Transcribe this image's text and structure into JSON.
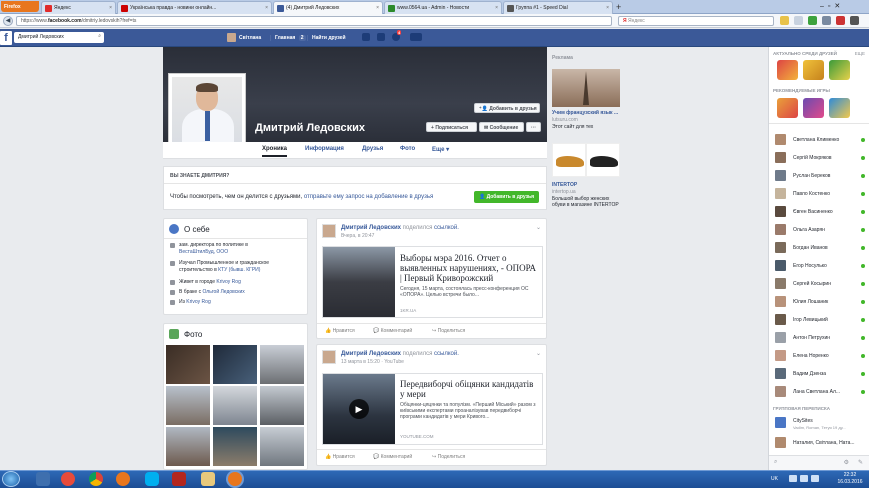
{
  "browser": {
    "menu_label": "Firefox",
    "tabs": [
      {
        "title": "Яндекс",
        "color": "#e02b2b"
      },
      {
        "title": "Українська правда - новини онлайн...",
        "color": "#c00"
      },
      {
        "title": "(4) Дмитрий Ледовских",
        "color": "#3b5998"
      },
      {
        "title": "www.0564.ua - Admin - Новости",
        "color": "#2c8a2c"
      },
      {
        "title": "Группа #1 - Speed Dial",
        "color": "#555"
      }
    ],
    "url_prefix": "https://www.",
    "url_domain": "facebook.com",
    "url_path": "/dmitriy.ledovskih?fref=ts",
    "search_placeholder": "Яндекс"
  },
  "fb": {
    "search_value": "Дмитрий Ледовских",
    "user_name": "Світлана",
    "nav_home": "Главная",
    "nav_home_count": "2",
    "nav_find_friends": "Найти друзей",
    "notif_count": "4"
  },
  "profile": {
    "name": "Дмитрий Ледовских",
    "add_friend_button": "Добавить в друзья",
    "follow_button": "Подписаться",
    "message_button": "Сообщение",
    "more_button": "···",
    "tabs": [
      "Хроника",
      "Информация",
      "Друзья",
      "Фото",
      "Еще"
    ]
  },
  "know": {
    "title": "ВЫ ЗНАЕТЕ ДМИТРИЯ?",
    "text": "Чтобы посмотреть, чем он делится с друзьями,",
    "link": "отправьте ему запрос на добавление в друзья",
    "button": "Добавить в друзья"
  },
  "about": {
    "title": "О себе",
    "rows": [
      {
        "text": "зам. директора по политике в",
        "link": "ВестаШтилБуд, ООО"
      },
      {
        "text": "Изучал Промышленное и гражданское строительство в",
        "link": "КТУ (бывш. КГРИ)"
      },
      {
        "text": "Живет в городе",
        "link": "Krivoy Rog"
      },
      {
        "text": "В браке с",
        "link": "Ольгой Ледовских"
      },
      {
        "text": "Из",
        "link": "Krivoy Rog"
      }
    ]
  },
  "photos": {
    "title": "Фото"
  },
  "posts": [
    {
      "author": "Дмитрий Ледовских",
      "shared": "поделился",
      "shared_what": "ссылкой.",
      "time": "Вчера, в 20:47",
      "link_title": "Выборы мэра 2016. Отчет о выявленных нарушениях, - ОПОРА | Первый Криворожский",
      "link_desc": "Сегодня, 15 марта, состоялась пресс-конференция ОС «ОПОРА». Целью встречи было...",
      "link_source": "1KR.UA",
      "like": "Нравится",
      "comment": "Комментарий",
      "share": "Поделиться"
    },
    {
      "author": "Дмитрий Ледовских",
      "shared": "поделился",
      "shared_what": "ссылкой.",
      "time": "13 марта в 15:20",
      "via": "YouTube",
      "link_title": "Передвиборчі обіцянки кандидатів у мери",
      "link_desc": "Обіцянки-цяцянки та популізм. «Перший Міський» разом з київськими експертами проаналізував передвиборчі програми кандидатів у мери Кривого...",
      "link_source": "YOUTUBE.COM",
      "like": "Нравится",
      "comment": "Комментарий",
      "share": "Поделиться"
    }
  ],
  "ads": {
    "title": "Реклама",
    "ad1_title": "Учим французский язык ...",
    "ad1_site": "lutsuru.com",
    "ad1_text": "Этот сайт для тех",
    "ad2_title": "INTERTOP",
    "ad2_site": "intertop.ua",
    "ad2_text": "Большой выбор женских обуви в магазине INTERTOP"
  },
  "chat": {
    "header_games": "АКТУАЛЬНО СРЕДИ ДРУЗЕЙ",
    "header_recommended": "РЕКОМЕНДУЕМЫЕ ИГРЫ",
    "see_all": "ЕЩЕ",
    "contacts": [
      "Светлана Клименко",
      "Сергій Мокряков",
      "Руслан Береков",
      "Павло Костенко",
      "Євген Васиненко",
      "Ольга Азарян",
      "Богдан Иванов",
      "Егор Носулько",
      "Сергей Косырин",
      "Юлия Лошаник",
      "Ігор Левицький",
      "Антон Петрухин",
      "Елена Норенко",
      "Вадим Дзенза",
      "Лана Светлана Ал..."
    ],
    "group_header": "ГРУППОВАЯ ПЕРЕПИСКА",
    "groups": [
      {
        "name": "CitySites",
        "members": "Vadim, Roman, Тетуя 19 ду..."
      },
      {
        "name": "Наталия, Світлана, Ната...",
        "members": ""
      }
    ]
  },
  "taskbar": {
    "lang": "UK",
    "time": "22:32",
    "date": "16.03.2016"
  }
}
